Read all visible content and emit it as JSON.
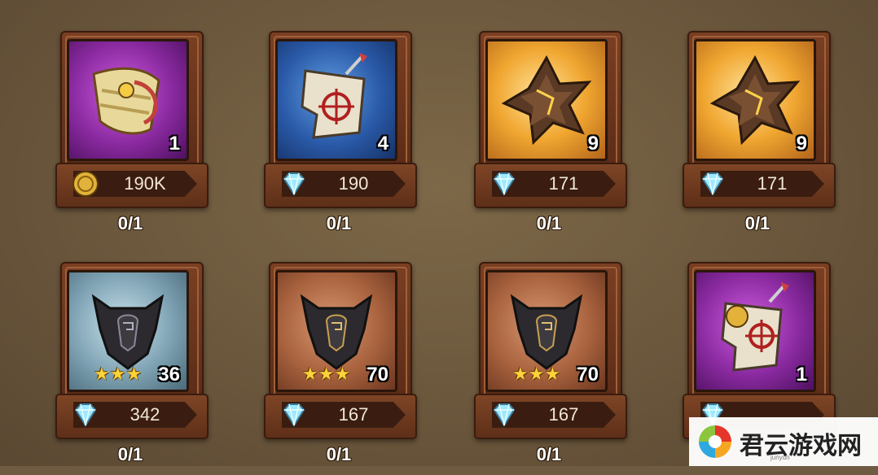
{
  "items": [
    {
      "icon": "scroll-bundle-icon",
      "tile": "purple",
      "quantity": "1",
      "currency": "gold-coin-icon",
      "price": "190K",
      "count": "0/1"
    },
    {
      "icon": "target-map-icon",
      "tile": "blue",
      "quantity": "4",
      "currency": "diamond-icon",
      "price": "190",
      "count": "0/1"
    },
    {
      "icon": "star-crystal-icon",
      "tile": "gold",
      "quantity": "9",
      "currency": "diamond-icon",
      "price": "171",
      "count": "0/1"
    },
    {
      "icon": "star-crystal-icon",
      "tile": "gold",
      "quantity": "9",
      "currency": "diamond-icon",
      "price": "171",
      "count": "0/1"
    },
    {
      "icon": "armor-emblem-icon",
      "tile": "silver",
      "quantity": "36",
      "stars": 3,
      "currency": "diamond-icon",
      "price": "342",
      "count": "0/1"
    },
    {
      "icon": "armor-emblem-icon",
      "tile": "copper",
      "quantity": "70",
      "stars": 3,
      "currency": "diamond-icon",
      "price": "167",
      "count": "0/1"
    },
    {
      "icon": "armor-emblem-icon",
      "tile": "copper",
      "quantity": "70",
      "stars": 3,
      "currency": "diamond-icon",
      "price": "167",
      "count": "0/1"
    },
    {
      "icon": "sealed-map-icon",
      "tile": "purple",
      "quantity": "1",
      "currency": "diamond-icon",
      "price": "",
      "count": ""
    }
  ],
  "watermark": {
    "text": "君云游戏网",
    "small": "junyun"
  },
  "colors": {
    "diamond": "#9fe8ff",
    "gold": "#d8a030",
    "text": "#ffffff"
  }
}
